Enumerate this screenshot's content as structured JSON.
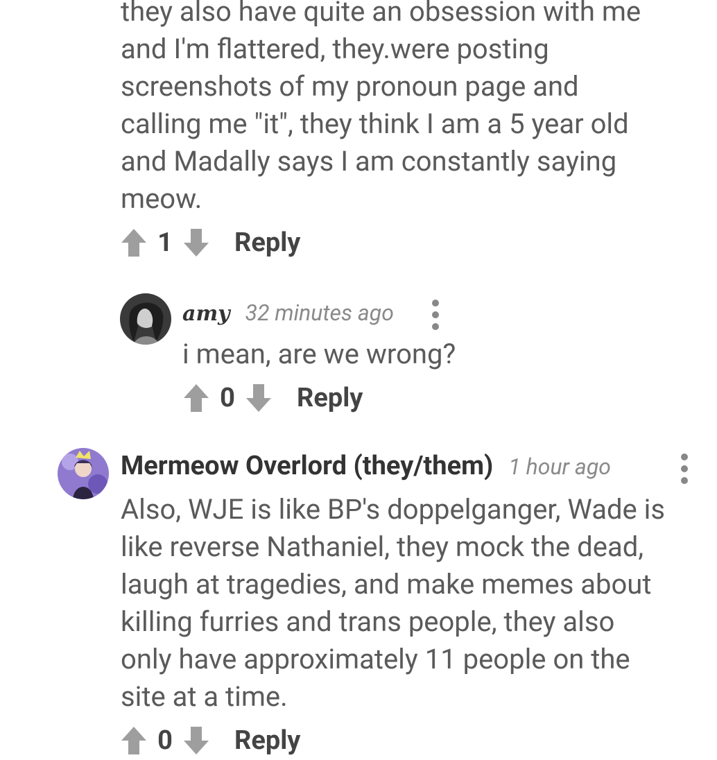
{
  "comments": [
    {
      "id": "top-comment",
      "body_lines": [
        "they also have quite an obsession with me",
        "and I'm flattered, they.were posting",
        "screenshots of my pronoun page and",
        "calling me \"it\", they think I am a 5 year old",
        "and Madally says I am constantly saying",
        "meow."
      ],
      "votes": "1",
      "reply_label": "Reply"
    },
    {
      "id": "amy-comment",
      "author": "amy",
      "timestamp": "32 minutes ago",
      "body_lines": [
        "i mean, are we wrong?"
      ],
      "votes": "0",
      "reply_label": "Reply"
    },
    {
      "id": "mermeow-comment",
      "author": "Mermeow Overlord (they/them)",
      "timestamp": "1 hour ago",
      "body_lines": [
        "Also, WJE is like BP's doppelganger, Wade is",
        "like reverse Nathaniel, they mock the dead,",
        "laugh at tragedies, and make memes about",
        "killing furries and trans people, they also",
        "only have approximately 11 people on the",
        "site at a time."
      ],
      "votes": "0",
      "reply_label": "Reply"
    }
  ],
  "icons": {
    "upvote": "arrow-up-icon",
    "downvote": "arrow-down-icon",
    "more": "more-vertical-icon"
  },
  "colors": {
    "text": "#5a5a5a",
    "author": "#333333",
    "timestamp": "#8a8a8a",
    "vote_icon": "#9e9e9e"
  }
}
